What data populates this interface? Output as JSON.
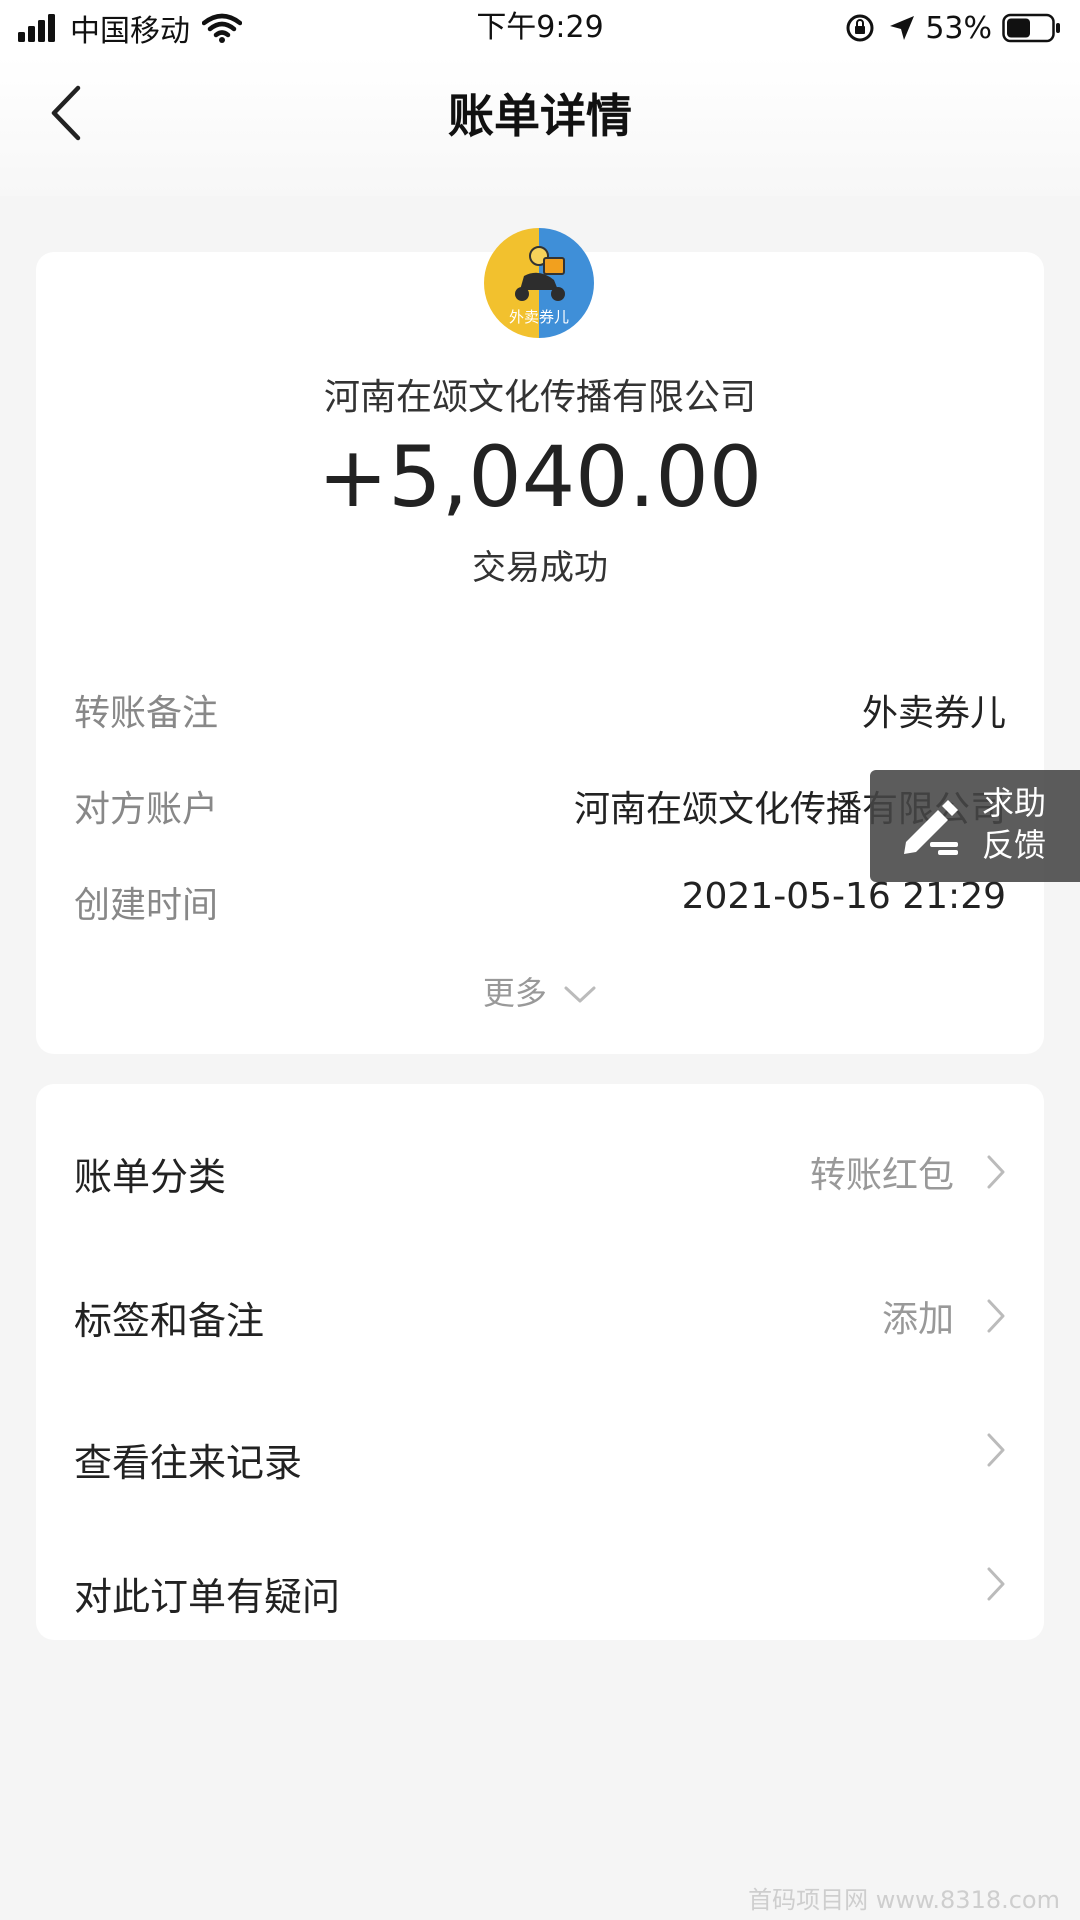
{
  "status_bar": {
    "carrier": "中国移动",
    "time": "下午9:29",
    "battery_percent": "53%",
    "battery_level": 0.53
  },
  "nav": {
    "title": "账单详情"
  },
  "transaction": {
    "merchant_name": "河南在颂文化传播有限公司",
    "avatar_label": "外卖券儿",
    "amount": "+5,040.00",
    "status": "交易成功",
    "details": [
      {
        "label": "转账备注",
        "value": "外卖券儿"
      },
      {
        "label": "对方账户",
        "value": "河南在颂文化传播有限公司"
      },
      {
        "label": "创建时间",
        "value": "2021-05-16 21:29"
      }
    ],
    "more_label": "更多"
  },
  "menu": {
    "items": [
      {
        "label": "账单分类",
        "value": "转账红包"
      },
      {
        "label": "标签和备注",
        "value": "添加"
      },
      {
        "label": "查看往来记录",
        "value": ""
      },
      {
        "label": "对此订单有疑问",
        "value": ""
      }
    ]
  },
  "help_button": {
    "line1": "求助",
    "line2": "反馈"
  },
  "watermark": "首码项目网 www.8318.com",
  "colors": {
    "avatar_yellow": "#f2c12e",
    "avatar_blue": "#3f8fd8",
    "background": "#f5f5f5",
    "card": "#ffffff"
  }
}
